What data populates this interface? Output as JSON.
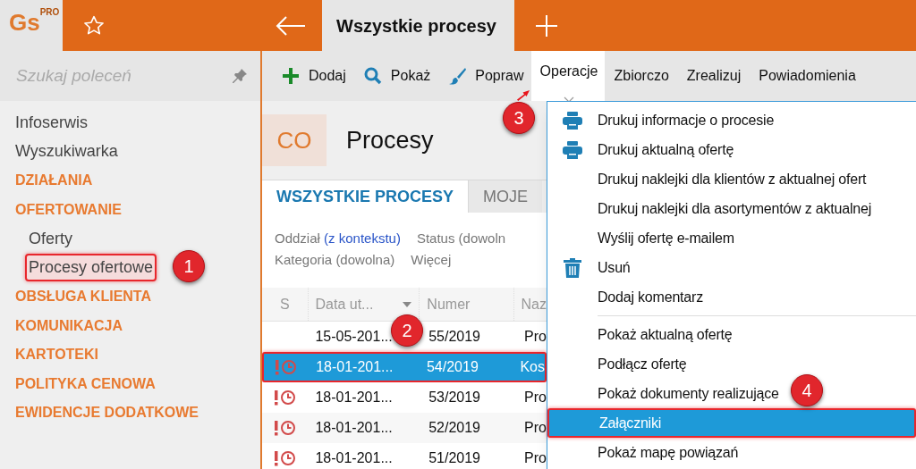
{
  "app": {
    "logo": "Gs",
    "logo_badge": "PRO"
  },
  "tab": {
    "title": "Wszystkie procesy"
  },
  "search": {
    "placeholder": "Szukaj poleceń"
  },
  "toolbar": [
    {
      "kind": "add",
      "label": "Dodaj",
      "selected": false
    },
    {
      "kind": "show",
      "label": "Pokaż",
      "selected": false
    },
    {
      "kind": "edit",
      "label": "Popraw",
      "selected": false
    },
    {
      "kind": "menu",
      "label": "Operacje",
      "selected": true,
      "badge": "3"
    },
    {
      "kind": "text",
      "label": "Zbiorczo",
      "selected": false
    },
    {
      "kind": "text",
      "label": "Zrealizuj",
      "selected": false
    },
    {
      "kind": "text",
      "label": "Powiadomienia",
      "selected": false
    }
  ],
  "sidebar": {
    "items": [
      {
        "kind": "link",
        "label": "Infoserwis"
      },
      {
        "kind": "link",
        "label": "Wyszukiwarka"
      },
      {
        "kind": "section",
        "label": "DZIAŁANIA"
      },
      {
        "kind": "section",
        "label": "OFERTOWANIE",
        "children": [
          {
            "kind": "link",
            "label": "Oferty",
            "highlighted": false
          },
          {
            "kind": "link",
            "label": "Procesy ofertowe",
            "highlighted": true,
            "badge": "1"
          }
        ]
      },
      {
        "kind": "section",
        "label": "OBSŁUGA KLIENTA"
      },
      {
        "kind": "section",
        "label": "KOMUNIKACJA"
      },
      {
        "kind": "section",
        "label": "KARTOTEKI"
      },
      {
        "kind": "section",
        "label": "POLITYKA CENOWA"
      },
      {
        "kind": "section",
        "label": "EWIDENCJE DODATKOWE"
      }
    ]
  },
  "module": {
    "code": "CO",
    "title": "Procesy"
  },
  "view_tabs": [
    {
      "label": "WSZYSTKIE PROCESY",
      "selected": true
    },
    {
      "label": "MOJE",
      "selected": false
    }
  ],
  "filters": [
    [
      {
        "label": "Oddział **(z kontekstu)**"
      },
      {
        "label": "Status (dowoln"
      }
    ],
    [
      {
        "label": "Kategoria (dowolna)"
      },
      {
        "label": "Więcej"
      }
    ]
  ],
  "table": {
    "columns": [
      "S",
      "Data ut...",
      "Numer",
      "Naz"
    ],
    "rows": [
      {
        "overdue": false,
        "date": "15-05-201...",
        "number": "55/2019",
        "column_4": "Pro",
        "selected": false,
        "badge": "2"
      },
      {
        "overdue": true,
        "date": "18-01-201...",
        "number": "54/2019",
        "column_4": "Kos",
        "selected": true
      },
      {
        "overdue": true,
        "date": "18-01-201...",
        "number": "53/2019",
        "column_4": "Pro",
        "selected": false
      },
      {
        "overdue": true,
        "date": "18-01-201...",
        "number": "52/2019",
        "column_4": "Pro",
        "selected": false
      },
      {
        "overdue": true,
        "date": "18-01-201...",
        "number": "51/2019",
        "column_4": "Pro",
        "selected": false
      }
    ]
  },
  "menu": [
    {
      "kind": "print",
      "label": "Drukuj informacje o procesie",
      "selected": false
    },
    {
      "kind": "print",
      "label": "Drukuj aktualną ofertę",
      "selected": false
    },
    {
      "kind": "text",
      "label": "Drukuj naklejki dla klientów z aktualnej ofert",
      "selected": false
    },
    {
      "kind": "text",
      "label": "Drukuj naklejki dla asortymentów z aktualnej",
      "selected": false
    },
    {
      "kind": "text",
      "label": "Wyślij ofertę e-mailem",
      "selected": false
    },
    {
      "kind": "delete",
      "label": "Usuń",
      "selected": false
    },
    {
      "kind": "text",
      "label": "Dodaj komentarz",
      "selected": false
    },
    {
      "kind": "separator"
    },
    {
      "kind": "text",
      "label": "Pokaż aktualną ofertę",
      "selected": false
    },
    {
      "kind": "text",
      "label": "Podłącz ofertę",
      "selected": false
    },
    {
      "kind": "text",
      "label": "Pokaż dokumenty realizujące",
      "selected": false,
      "badge": "4"
    },
    {
      "kind": "text",
      "label": "Załączniki",
      "selected": true
    },
    {
      "kind": "text",
      "label": "Pokaż mapę powiązań",
      "selected": false
    }
  ]
}
